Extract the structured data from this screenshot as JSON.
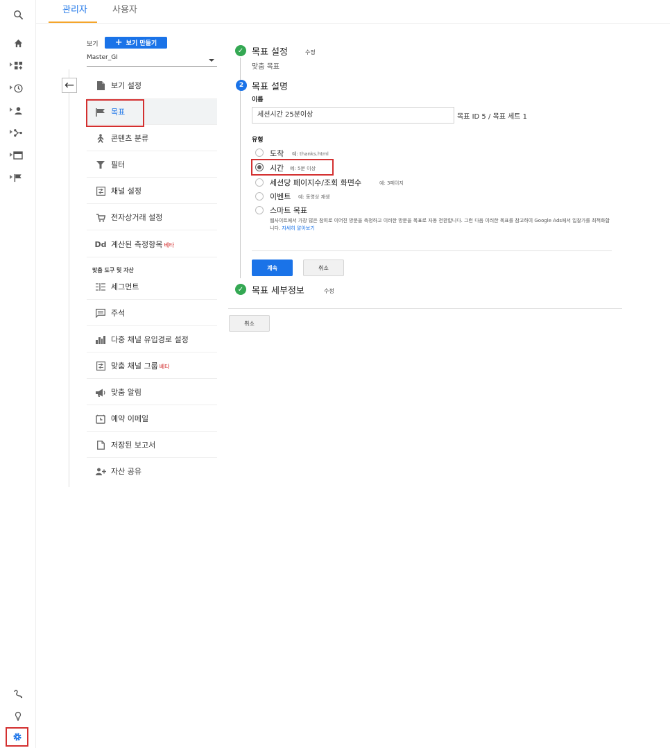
{
  "app": {
    "accent_color": "#1a73e8",
    "highlight_color": "#d32f2f",
    "success_color": "#34a853"
  },
  "rail": {
    "top_icons": [
      "search-icon",
      "home-icon",
      "dashboard-icon",
      "clock-icon",
      "person-icon",
      "acquisition-icon",
      "behavior-icon",
      "flag-icon"
    ],
    "bottom_icons": [
      "discover-icon",
      "lightbulb-icon",
      "gear-icon"
    ]
  },
  "tabs": [
    {
      "label": "관리자",
      "active": true
    },
    {
      "label": "사용자",
      "active": false
    }
  ],
  "view": {
    "label": "보기",
    "create_button": "보기 만들기",
    "selected": "Master_GI"
  },
  "menu": {
    "items": [
      {
        "label": "보기 설정",
        "icon": "document-icon"
      },
      {
        "label": "목표",
        "icon": "flag-icon",
        "active": true
      },
      {
        "label": "콘텐츠 분류",
        "icon": "person-walking-icon"
      },
      {
        "label": "필터",
        "icon": "filter-icon"
      },
      {
        "label": "채널 설정",
        "icon": "channel-icon"
      },
      {
        "label": "전자상거래 설정",
        "icon": "cart-icon"
      },
      {
        "label": "계산된 측정항목",
        "beta": "베타",
        "icon": "dd-icon"
      }
    ],
    "section_title": "맞춤 도구 및 자산",
    "tool_items": [
      {
        "label": "세그먼트",
        "icon": "segment-icon"
      },
      {
        "label": "주석",
        "icon": "comment-icon"
      },
      {
        "label": "다중 채널 유입경로 설정",
        "icon": "bar-chart-icon"
      },
      {
        "label": "맞춤 채널 그룹",
        "beta": "베타",
        "icon": "channel-group-icon"
      },
      {
        "label": "맞춤 알림",
        "icon": "megaphone-icon"
      },
      {
        "label": "예약 이메일",
        "icon": "alarm-icon"
      },
      {
        "label": "저장된 보고서",
        "icon": "saved-report-icon"
      },
      {
        "label": "자산 공유",
        "icon": "person-add-icon"
      }
    ]
  },
  "goal": {
    "step1": {
      "title": "목표 설정",
      "edit": "수정",
      "subtitle": "맞춤 목표"
    },
    "step2": {
      "number": "2",
      "title": "목표 설명",
      "name_label": "이름",
      "name_value": "세션시간 25분이상",
      "goal_id": "목표 ID 5 / 목표 세트 1",
      "type_label": "유형",
      "types": [
        {
          "label": "도착",
          "example": "예: thanks.html",
          "selected": false
        },
        {
          "label": "시간",
          "example": "예: 5분 이상",
          "selected": true
        },
        {
          "label": "세션당 페이지수/조회 화면수",
          "example": "예: 3페이지",
          "selected": false
        },
        {
          "label": "이벤트",
          "example": "예: 동영상 재생",
          "selected": false
        },
        {
          "label": "스마트 목표",
          "example": "",
          "selected": false
        }
      ],
      "smart_description": "웹사이트에서 가장 많은 참여로 이어진 방문을 측정하고 이러한 방문을 목표로 자동 전환합니다. 그런 다음 이러한 목표를 참고하여 Google Ads에서 입찰가를 최적화합니다.",
      "learn_more": "자세히 알아보기",
      "continue_button": "계속",
      "cancel_button": "취소"
    },
    "step3": {
      "title": "목표 세부정보",
      "edit": "수정"
    },
    "bottom_cancel": "취소"
  }
}
